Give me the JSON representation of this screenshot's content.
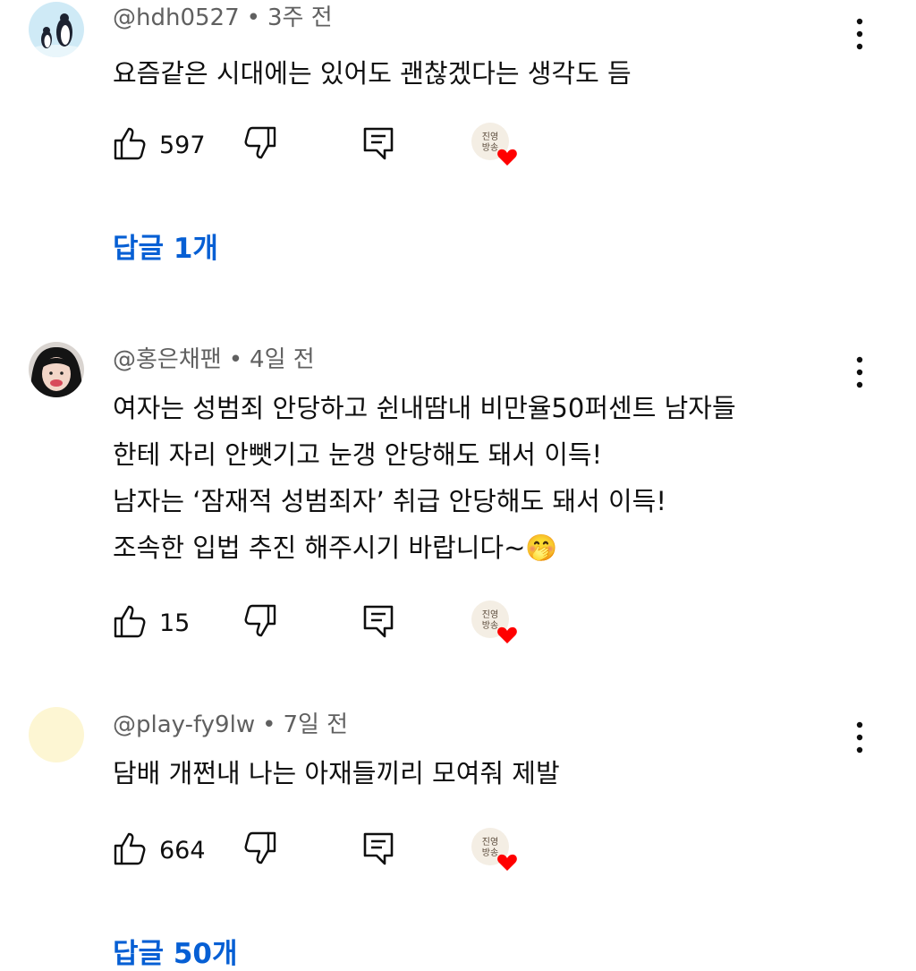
{
  "comments": [
    {
      "author": "@hdh0527",
      "time": "3주 전",
      "lines": [
        "요즘같은 시대에는 있어도 괜찮겠다는 생각도 듬"
      ],
      "likes": "597",
      "replies_label": "답글 1개",
      "avatar_icon": "penguin-avatar"
    },
    {
      "author": "@홍은채팬",
      "time": "4일 전",
      "lines": [
        "여자는 성범죄 안당하고 쉰내땀내 비만율50퍼센트 남자들",
        "한테 자리 안뺏기고 눈갱 안당해도 돼서 이득!",
        "남자는 ‘잠재적 성범죄자’ 취급 안당해도 돼서 이득!",
        "조속한 입법 추진 해주시기 바랍니다~"
      ],
      "emoji": "🤭",
      "likes": "15",
      "avatar_icon": "girl-avatar"
    },
    {
      "author": "@play-fy9lw",
      "time": "7일 전",
      "lines": [
        "담배 개쩐내 나는 아재들끼리 모여줘 제발"
      ],
      "likes": "664",
      "replies_label": "답글 50개",
      "avatar_icon": "blank-yellow-avatar"
    }
  ],
  "separator": "•",
  "creator_badge_text": "진영\n방송",
  "colors": {
    "link": "#065fd4",
    "meta": "#606060",
    "heart": "#ff0000"
  }
}
